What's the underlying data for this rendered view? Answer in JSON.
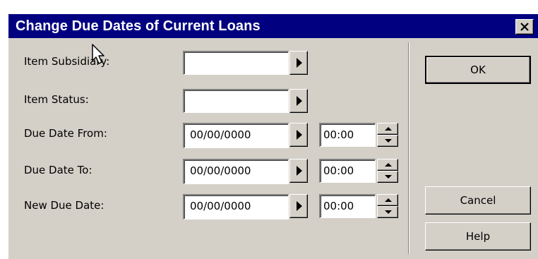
{
  "dialog": {
    "title": "Change Due Dates of Current Loans",
    "close_icon": "close-x-icon"
  },
  "form": {
    "item_subsidiary_label": "Item Subsidiary:",
    "item_subsidiary_value": "",
    "item_status_label": "Item Status:",
    "item_status_value": "",
    "due_date_from_label": "Due Date From:",
    "due_date_from_value": "00/00/0000",
    "due_date_from_time": "00:00",
    "due_date_to_label": "Due Date To:",
    "due_date_to_value": "00/00/0000",
    "due_date_to_time": "00:00",
    "new_due_date_label": "New Due Date:",
    "new_due_date_value": "00/00/0000",
    "new_due_date_time": "00:00"
  },
  "buttons": {
    "ok": "OK",
    "cancel": "Cancel",
    "help": "Help"
  },
  "colors": {
    "titlebar": "#000080",
    "face": "#d4d0c8"
  }
}
